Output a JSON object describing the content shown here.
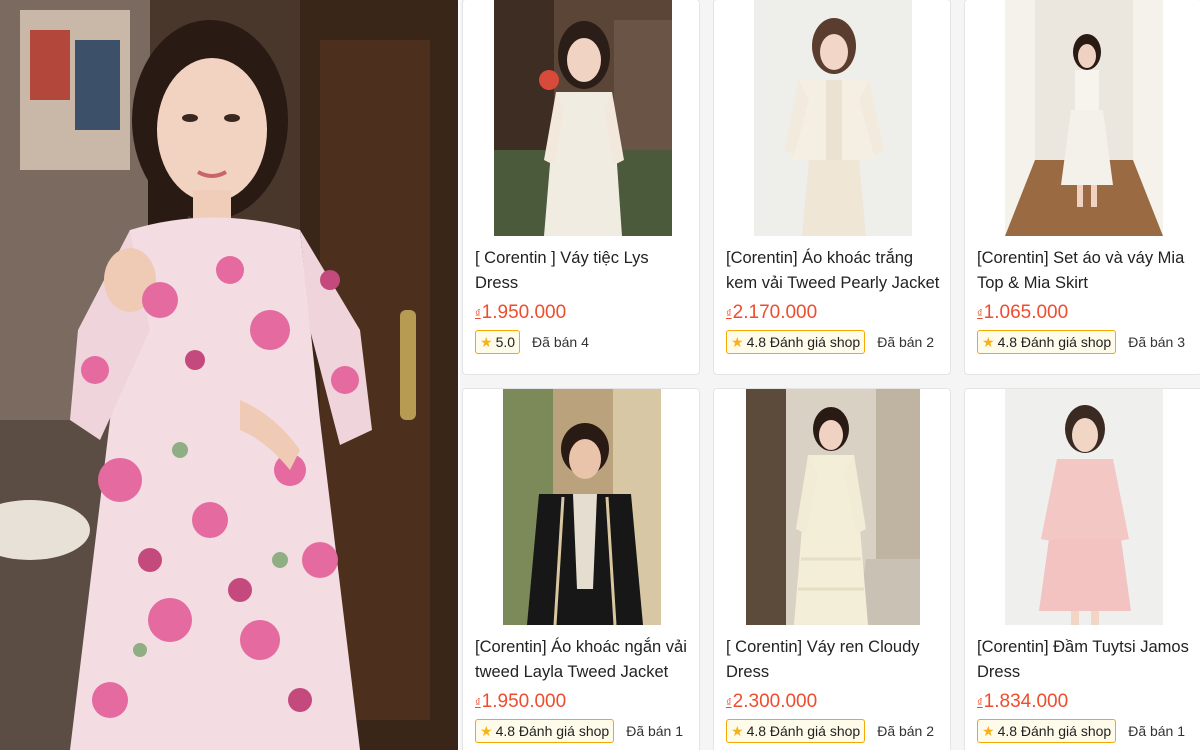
{
  "products": [
    {
      "title": "[ Corentin ] Váy tiệc Lys Dress",
      "currency": "₫",
      "price": "1.950.000",
      "rating_badge": "5.0",
      "sold": "Đã bán 4"
    },
    {
      "title": "[Corentin] Áo khoác trắng kem vải Tweed Pearly Jacket",
      "currency": "₫",
      "price": "2.170.000",
      "rating_badge": "4.8 Đánh giá shop",
      "sold": "Đã bán 2"
    },
    {
      "title": "[Corentin] Set áo và váy Mia Top & Mia Skirt",
      "currency": "₫",
      "price": "1.065.000",
      "rating_badge": "4.8 Đánh giá shop",
      "sold": "Đã bán 3"
    },
    {
      "title": "[Corentin] Áo khoác ngắn vải tweed Layla Tweed Jacket",
      "currency": "₫",
      "price": "1.950.000",
      "rating_badge": "4.8 Đánh giá shop",
      "sold": "Đã bán 1"
    },
    {
      "title": "[ Corentin] Váy ren Cloudy Dress",
      "currency": "₫",
      "price": "2.300.000",
      "rating_badge": "4.8 Đánh giá shop",
      "sold": "Đã bán 2"
    },
    {
      "title": "[Corentin] Đầm Tuytsi Jamos Dress",
      "currency": "₫",
      "price": "1.834.000",
      "rating_badge": "4.8 Đánh giá shop",
      "sold": "Đã bán 1"
    }
  ],
  "colors": {
    "price": "#ee4d2d",
    "badge_border": "#f6a700",
    "badge_bg": "#fffbea",
    "star": "#f6b21b"
  },
  "icons": {
    "rating": "star-icon"
  }
}
